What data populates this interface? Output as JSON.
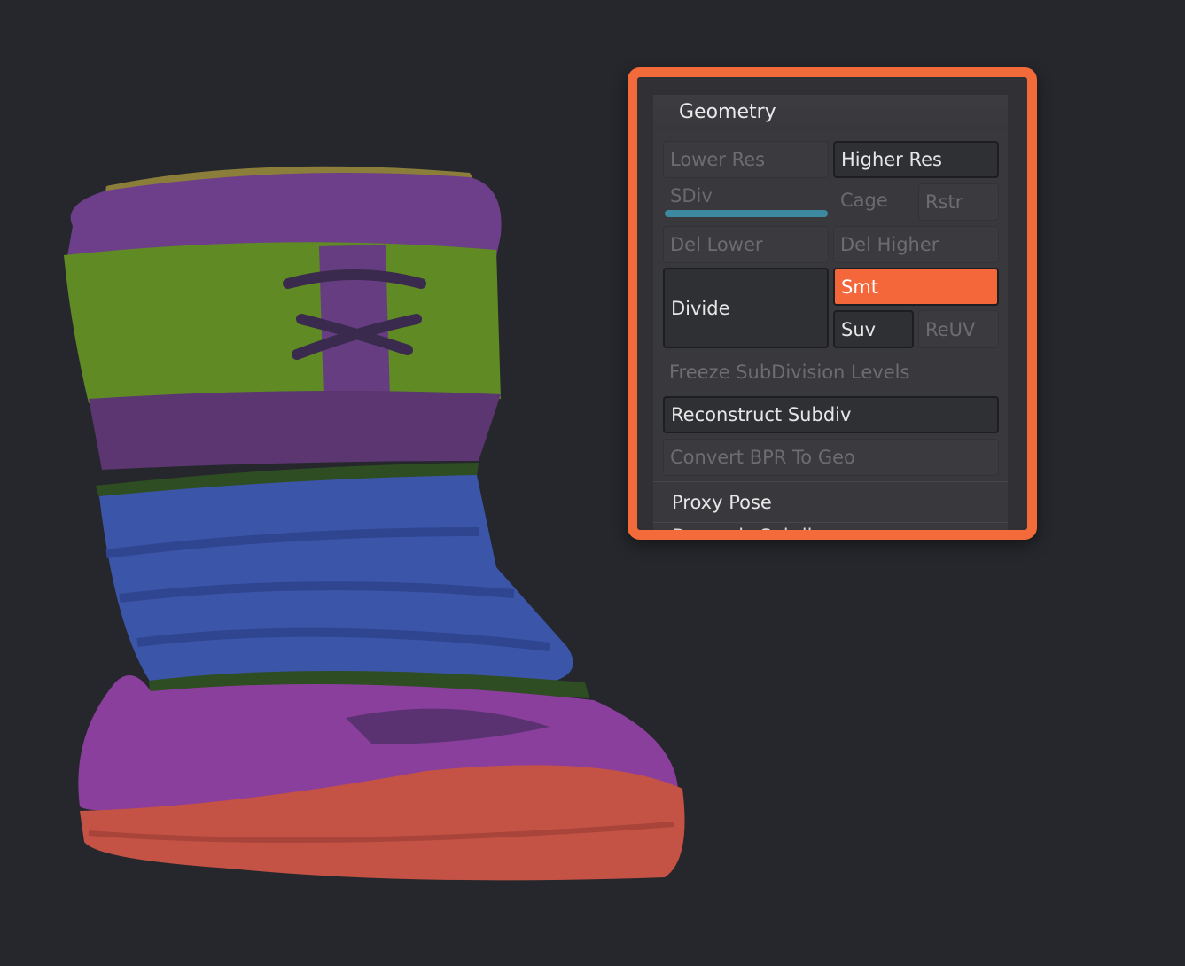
{
  "panel": {
    "title": "Geometry",
    "lower_res": "Lower Res",
    "higher_res": "Higher Res",
    "sdiv": "SDiv",
    "cage": "Cage",
    "rstr": "Rstr",
    "del_lower": "Del Lower",
    "del_higher": "Del Higher",
    "divide": "Divide",
    "smt": "Smt",
    "suv": "Suv",
    "reuv": "ReUV",
    "freeze": "Freeze SubDivision Levels",
    "reconstruct": "Reconstruct Subdiv",
    "convert": "Convert BPR To Geo",
    "proxy_pose": "Proxy Pose",
    "next_section_partial": "Dynamic Subdiv"
  },
  "colors": {
    "highlight_frame": "#f36b3a",
    "smt_active": "#f4673a",
    "sdiv_slider": "#3d8aa0",
    "background": "#26272c"
  },
  "icons": {
    "model": "boot-3d-model"
  }
}
